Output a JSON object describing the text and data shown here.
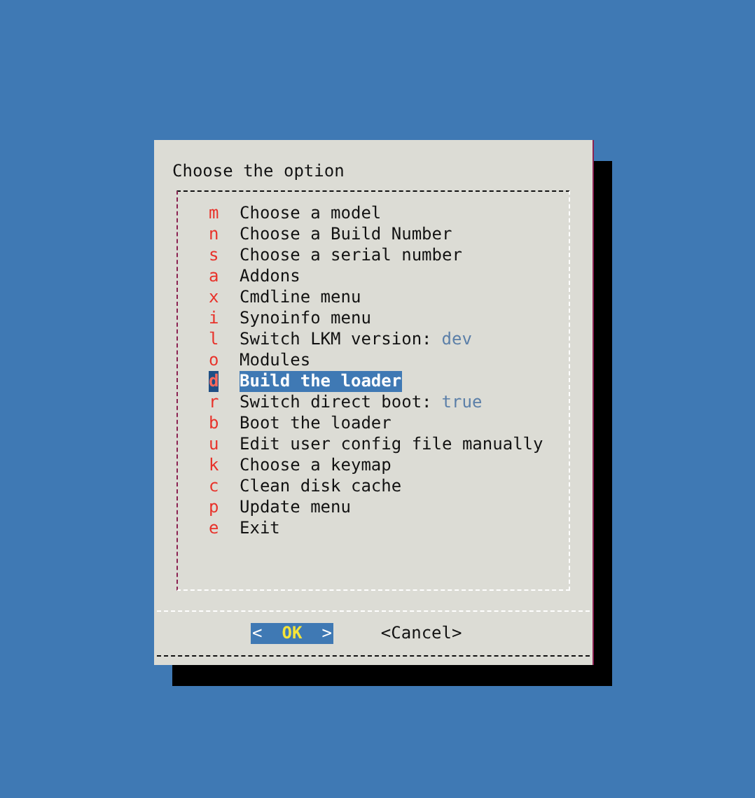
{
  "dialog": {
    "title": "Choose the option",
    "items": [
      {
        "key": "m",
        "label": "Choose a model",
        "selected": false
      },
      {
        "key": "n",
        "label": "Choose a Build Number",
        "selected": false
      },
      {
        "key": "s",
        "label": "Choose a serial number",
        "selected": false
      },
      {
        "key": "a",
        "label": "Addons",
        "selected": false
      },
      {
        "key": "x",
        "label": "Cmdline menu",
        "selected": false
      },
      {
        "key": "i",
        "label": "Synoinfo menu",
        "selected": false
      },
      {
        "key": "l",
        "label": "Switch LKM version:",
        "value": "dev",
        "selected": false
      },
      {
        "key": "o",
        "label": "Modules",
        "selected": false
      },
      {
        "key": "d",
        "label": "Build the loader",
        "selected": true
      },
      {
        "key": "r",
        "label": "Switch direct boot:",
        "value": "true",
        "selected": false
      },
      {
        "key": "b",
        "label": "Boot the loader",
        "selected": false
      },
      {
        "key": "u",
        "label": "Edit user config file manually",
        "selected": false
      },
      {
        "key": "k",
        "label": "Choose a keymap",
        "selected": false
      },
      {
        "key": "c",
        "label": "Clean disk cache",
        "selected": false
      },
      {
        "key": "p",
        "label": "Update menu",
        "selected": false
      },
      {
        "key": "e",
        "label": "Exit",
        "selected": false
      }
    ],
    "buttons": [
      {
        "open": "<",
        "label": "OK",
        "close": ">",
        "selected": true
      },
      {
        "open": "<",
        "label": "Cancel",
        "close": ">",
        "selected": false
      }
    ]
  }
}
